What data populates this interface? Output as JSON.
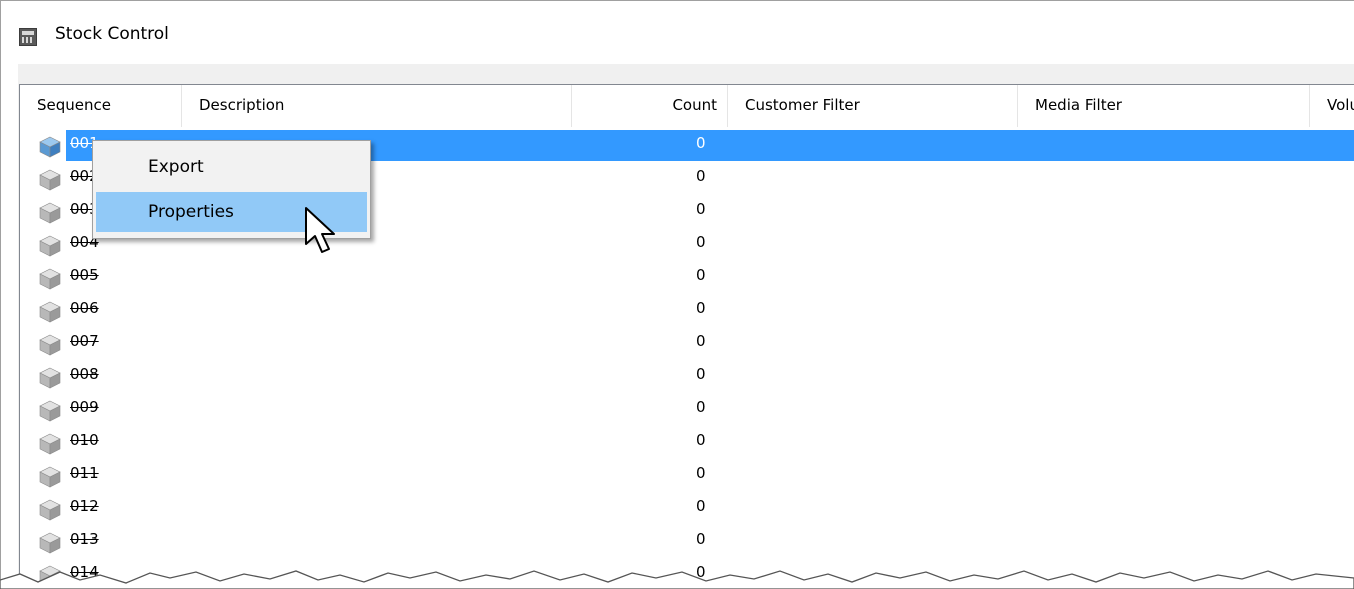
{
  "window": {
    "title": "Stock Control",
    "icon": "calculator-icon"
  },
  "columns": [
    {
      "label": "Sequence"
    },
    {
      "label": "Description"
    },
    {
      "label": "Count"
    },
    {
      "label": "Customer Filter"
    },
    {
      "label": "Media Filter"
    },
    {
      "label": "Volu"
    }
  ],
  "rows": [
    {
      "sequence": "001",
      "count": "0",
      "selected": true
    },
    {
      "sequence": "002",
      "count": "0"
    },
    {
      "sequence": "003",
      "count": "0"
    },
    {
      "sequence": "004",
      "count": "0"
    },
    {
      "sequence": "005",
      "count": "0"
    },
    {
      "sequence": "006",
      "count": "0"
    },
    {
      "sequence": "007",
      "count": "0"
    },
    {
      "sequence": "008",
      "count": "0"
    },
    {
      "sequence": "009",
      "count": "0"
    },
    {
      "sequence": "010",
      "count": "0"
    },
    {
      "sequence": "011",
      "count": "0"
    },
    {
      "sequence": "012",
      "count": "0"
    },
    {
      "sequence": "013",
      "count": "0"
    },
    {
      "sequence": "014",
      "count": "0"
    }
  ],
  "context_menu": {
    "items": [
      {
        "label": "Export"
      },
      {
        "label": "Properties",
        "hover": true
      }
    ]
  },
  "colors": {
    "selection": "#3399ff",
    "menu_hover": "#91c9f7"
  }
}
